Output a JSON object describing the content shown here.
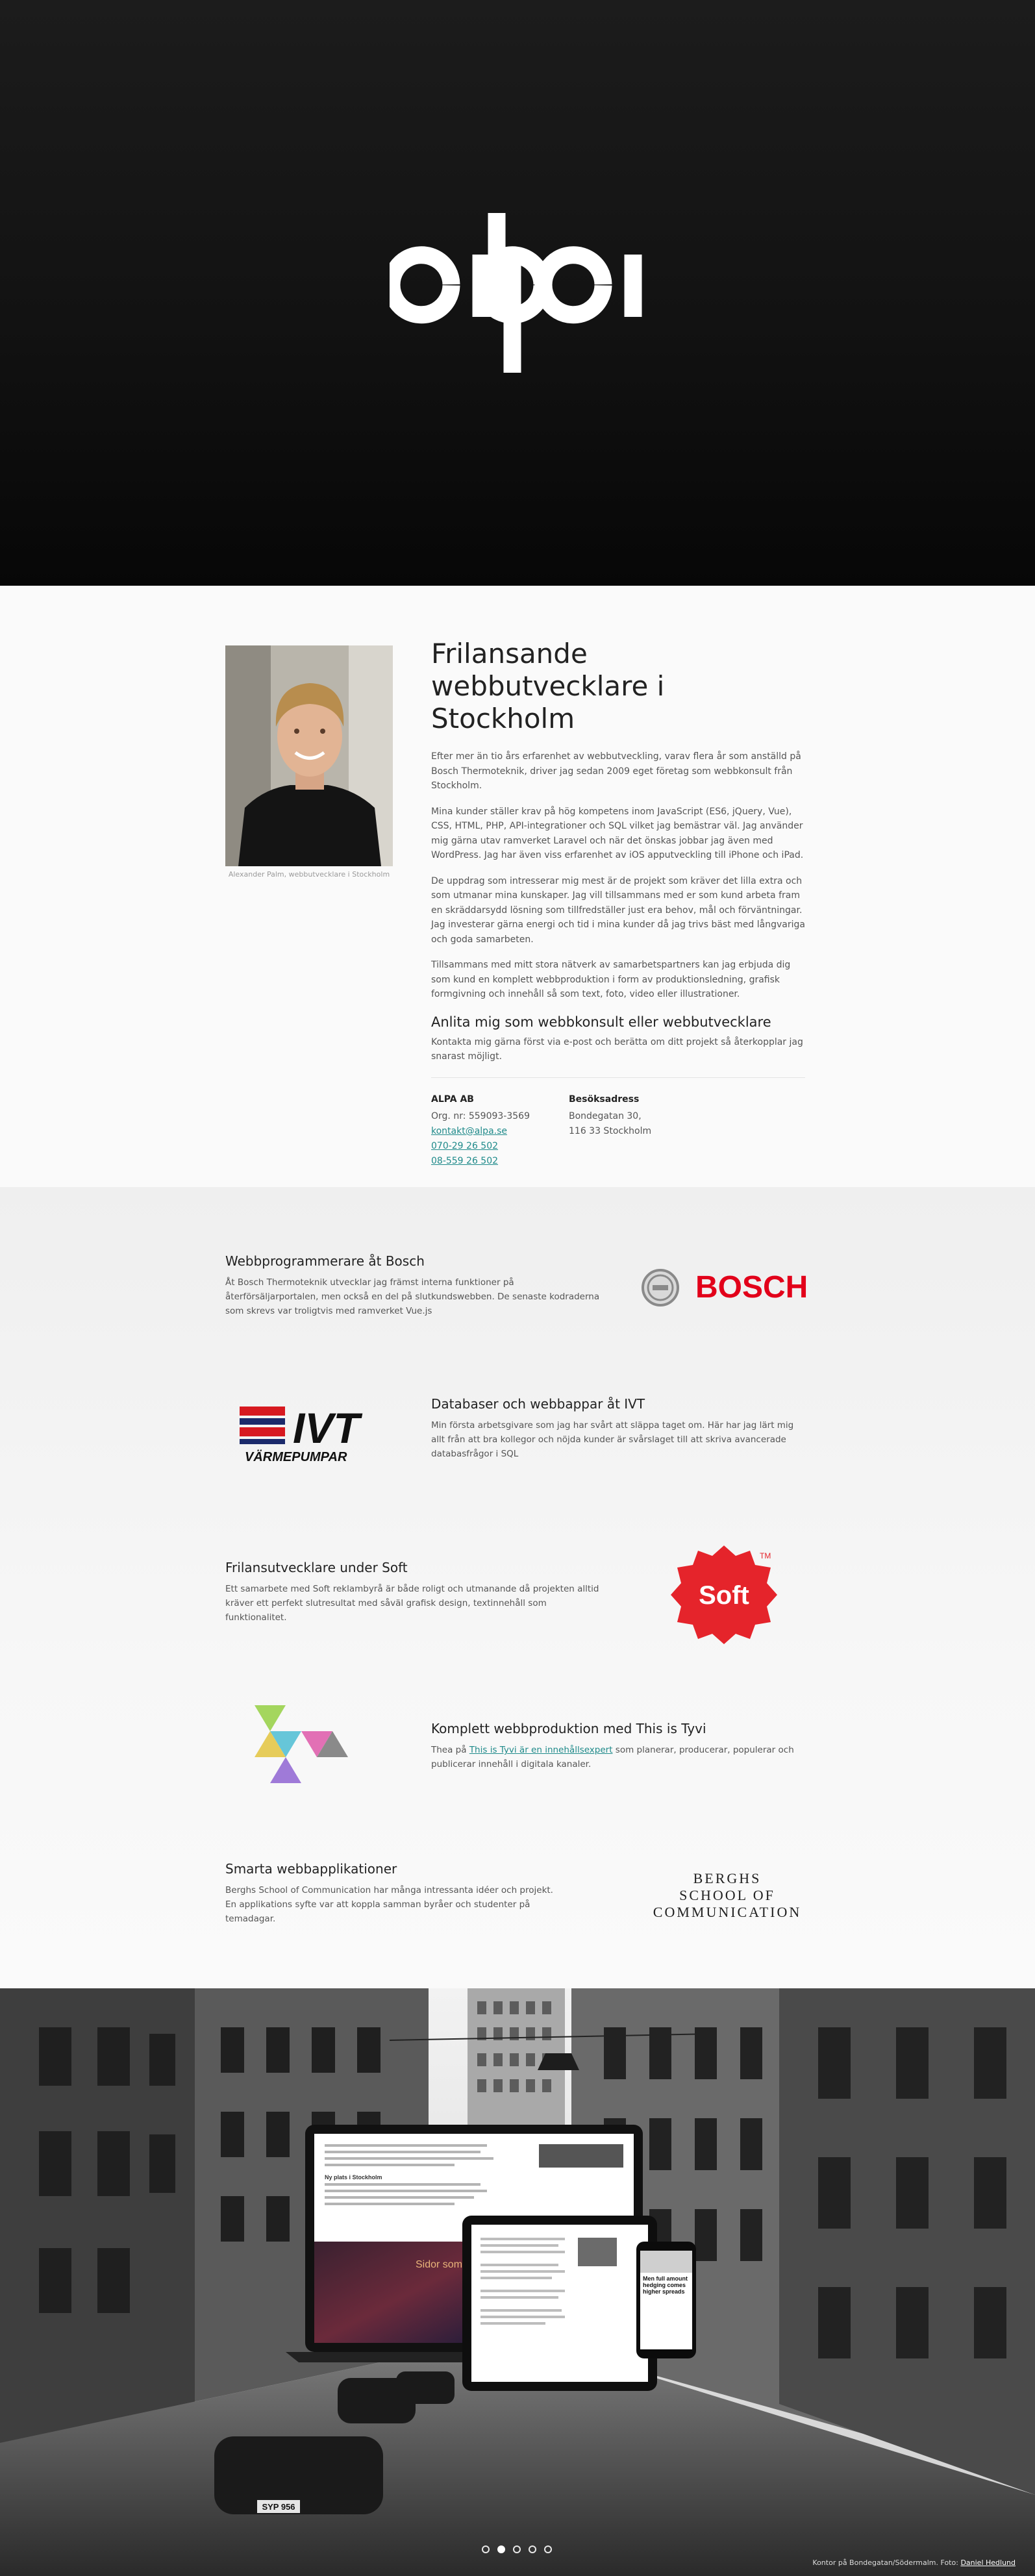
{
  "hero": {
    "logo_name": "alpa"
  },
  "intro": {
    "portrait_caption": "Alexander Palm, webbutvecklare i Stockholm",
    "title": "Frilansande webbutvecklare i Stockholm",
    "paragraphs": [
      "Efter mer än tio års erfarenhet av webbutveckling, varav flera år som anställd på Bosch Thermoteknik, driver jag sedan 2009 eget företag som webbkonsult från Stockholm.",
      "Mina kunder ställer krav på hög kompetens inom JavaScript (ES6, jQuery, Vue), CSS, HTML, PHP, API-integrationer och SQL vilket jag bemästrar väl. Jag använder mig gärna utav ramverket Laravel och när det önskas jobbar jag även med WordPress. Jag har även viss erfarenhet av iOS apputveckling till iPhone och iPad.",
      "De uppdrag som intresserar mig mest är de projekt som kräver det lilla extra och som utmanar mina kunskaper. Jag vill tillsammans med er som kund arbeta fram en skräddar­sydd lösning som tillfredställer just era behov, mål och förväntningar. Jag investerar gärna energi och tid i mina kunder då jag trivs bäst med långvariga och goda samarbeten.",
      "Tillsammans med mitt stora nätverk av samarbetspartners kan jag erbjuda dig som kund en komplett webbproduktion i form av produktionsledning, grafisk formgivning och innehåll så som text, foto, video eller illustrationer."
    ],
    "hire_title": "Anlita mig som webbkonsult eller webbutvecklare",
    "hire_text": "Kontakta mig gärna först via e-post och berätta om ditt projekt så återkopplar jag snarast möjligt.",
    "company": {
      "heading": "ALPA AB",
      "org": "Org. nr: 559093-3569",
      "email": "kontakt@alpa.se",
      "phone1": "070-29 26 502",
      "phone2": "08-559 26 502"
    },
    "visit": {
      "heading": "Besöksadress",
      "street": "Bondegatan 30,",
      "city": "116 33 Stockholm"
    }
  },
  "projects": [
    {
      "title": "Webbprogrammerare åt Bosch",
      "text": "Åt Bosch Thermoteknik utvecklar jag främst interna funktioner på återförsäljarportalen, men också en del på slutkundswebben. De senaste kodraderna som skrevs var troligtvis med ramverket Vue.js",
      "logo": "BOSCH"
    },
    {
      "title": "Databaser och webbappar åt IVT",
      "text": "Min första arbetsgivare som jag har svårt att släppa taget om. Här har jag lärt mig allt från att bra kollegor och nöjda kunder är svårslaget till att skriva avancerade databasfrågor i SQL",
      "logo": "IVT",
      "logo_sub": "VÄRMEPUMPAR"
    },
    {
      "title": "Frilansutvecklare under Soft",
      "text": "Ett samarbete med Soft reklambyrå är både roligt och utmanande då projekten alltid kräver ett perfekt slutresultat med såväl grafisk design, textinnehåll som funktionalitet.",
      "logo": "Soft",
      "logo_tm": "TM"
    },
    {
      "title": "Komplett webbproduktion med This is Tyvi",
      "text_pre": "Thea på ",
      "link": "This is Tyvi är en innehållsexpert",
      "text_post": " som planerar, producerar, populerar och publicerar innehåll i digitala kanaler.",
      "logo": "tyvi-triangles"
    },
    {
      "title": "Smarta webbapplikationer",
      "text": "Berghs School of Communication har många intressanta idéer och projekt. En applikations syfte var att koppla samman byråer och studenter på temadagar.",
      "logo_lines": [
        "BERGHS",
        "SCHOOL OF",
        "COMMUNICATION"
      ]
    }
  ],
  "showcase": {
    "laptop_heading": "Ny plats i Stockholm",
    "phone_heading": "Men full amount hedging comes higher spreads",
    "laptop_image_text": "Sidor som är din upplevelse",
    "car_plate": "SYP 956"
  },
  "footer": {
    "credit_text": "Kontor på Bondegatan/Södermalm. Foto: ",
    "credit_link": "Daniel Hedlund"
  },
  "colors": {
    "accent": "#1f8a8a",
    "bosch_red": "#e2001a",
    "soft_red": "#e5242b",
    "ivt_red": "#d71920",
    "ivt_navy": "#1b2a6b"
  }
}
